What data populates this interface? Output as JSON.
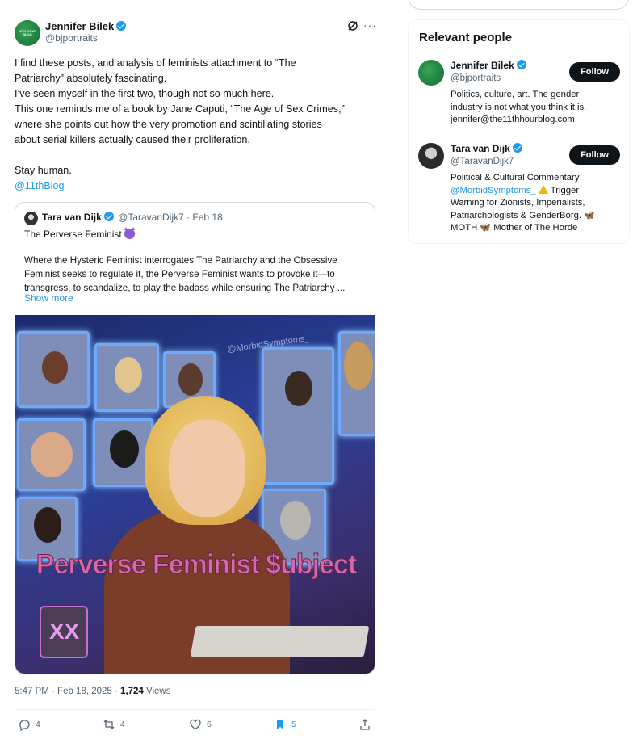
{
  "post": {
    "author_name": "Jennifer Bilek",
    "author_handle": "@bjportraits",
    "more_label": "···",
    "text_lines": [
      "I find these posts, and analysis of feminists attachment to “The",
      "Patriarchy” absolutely fascinating.",
      "I’ve seen myself in the first two, though not so much here.",
      "This one reminds me of a book by Jane Caputi, “The Age of Sex Crimes,”",
      "where she points out how the very promotion and scintillating stories",
      "about serial killers actually caused their proliferation."
    ],
    "closing": "Stay human.",
    "mention": "@11thBlog",
    "time": "5:47 PM · Feb 18, 2025 · ",
    "views_count": "1,724",
    "views_label": " Views"
  },
  "quote": {
    "author_name": "Tara van Dijk",
    "author_handle": "@TaravanDijk7 · Feb 18",
    "title": "The Perverse Feminist",
    "body_lines": [
      "Where the Hysteric Feminist interrogates The Patriarchy and the Obsessive",
      "Feminist seeks to regulate it, the Perverse Feminist wants to provoke it—to",
      "transgress, to scandalize, to play the badass while ensuring The Patriarchy ..."
    ],
    "show_more": "Show more",
    "image_overlay_text": "Perverse Feminist $ubject",
    "image_watermark": "@MorbidSymptoms_",
    "mug_text": "XX"
  },
  "actions": {
    "replies": "4",
    "reposts": "4",
    "likes": "6",
    "bookmarks": "5"
  },
  "relevant_people": {
    "title": "Relevant people",
    "people": [
      {
        "name": "Jennifer Bilek",
        "handle": "@bjportraits",
        "follow_label": "Follow",
        "bio_lines": [
          "Politics, culture, art. The gender",
          "industry is not what you think it is.",
          "jennifer@the11thhourblog.com"
        ]
      },
      {
        "name": "Tara van Dijk",
        "handle": "@TaravanDijk7",
        "follow_label": "Follow",
        "bio_line1": "Political & Cultural Commentary",
        "bio_mention": "@MorbidSymptoms_",
        "bio_after_mention": " Trigger",
        "bio_line3": "Warning for Zionists, Imperialists,",
        "bio_line4": "Patriarchologists & GenderBorg.",
        "bio_line5_a": "MOTH",
        "bio_line5_b": " Mother of The Horde"
      }
    ]
  },
  "colors": {
    "accent": "#1d9bf0",
    "text": "#0f1419",
    "secondary": "#536471",
    "follow_bg": "#0f1419"
  },
  "icons": [
    "grok-icon",
    "more-icon",
    "verified-icon",
    "devil-emoji-icon",
    "reply-icon",
    "repost-icon",
    "like-icon",
    "bookmark-icon",
    "share-icon",
    "warning-emoji-icon",
    "butterfly-emoji-icon"
  ]
}
